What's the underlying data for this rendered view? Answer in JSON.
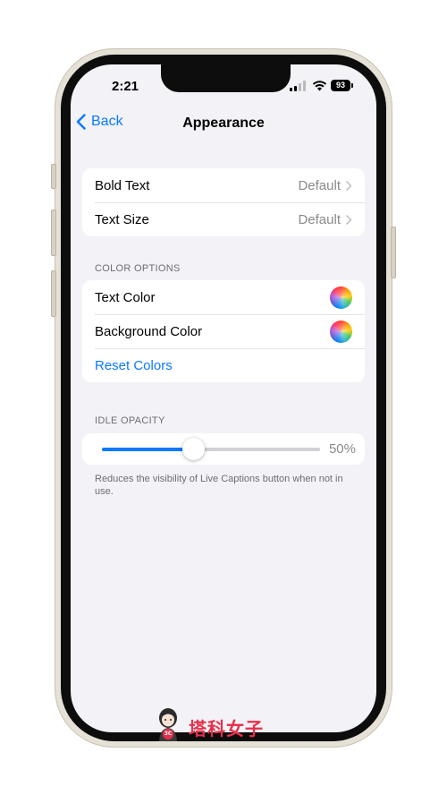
{
  "status_bar": {
    "time": "2:21",
    "battery": "93"
  },
  "nav": {
    "back_label": "Back",
    "title": "Appearance"
  },
  "text_group": [
    {
      "label": "Bold Text",
      "value": "Default"
    },
    {
      "label": "Text Size",
      "value": "Default"
    }
  ],
  "color_options": {
    "header": "COLOR OPTIONS",
    "rows": [
      {
        "label": "Text Color"
      },
      {
        "label": "Background Color"
      }
    ],
    "reset_label": "Reset Colors"
  },
  "idle_opacity": {
    "header": "IDLE OPACITY",
    "value_label": "50%",
    "level": 0.42,
    "footnote": "Reduces the visibility of Live Captions button when not in use."
  },
  "watermark": {
    "text": "塔科女子",
    "badge": "3C"
  },
  "colors": {
    "accent": "#0a7aff",
    "background": "#f2f2f7",
    "watermark": "#e8304a"
  }
}
